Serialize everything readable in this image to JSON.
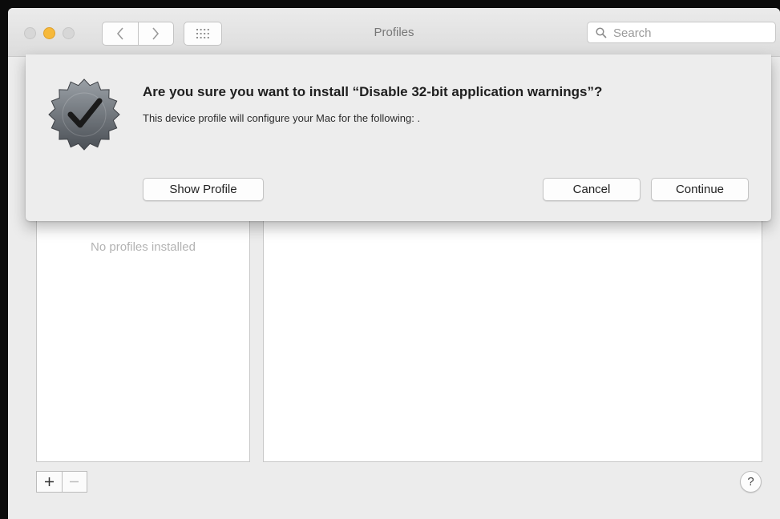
{
  "window": {
    "title": "Profiles"
  },
  "search": {
    "placeholder": "Search"
  },
  "profiles_list": {
    "empty_text": "No profiles installed"
  },
  "dialog": {
    "title": "Are you sure you want to install “Disable 32-bit application warnings”?",
    "message": "This device profile will configure your Mac for the following: .",
    "show_profile_label": "Show Profile",
    "cancel_label": "Cancel",
    "continue_label": "Continue"
  },
  "toolbar_bottom": {
    "add_label": "+",
    "remove_label": "−",
    "help_label": "?"
  },
  "icons": {
    "back": "chevron-left-icon",
    "forward": "chevron-right-icon",
    "grid": "grid-icon",
    "search": "search-icon",
    "badge": "verified-checkmark-badge-icon"
  },
  "colors": {
    "minimize_button": "#f6b93b",
    "window_background": "#ececec",
    "sheet_background": "#ededed"
  }
}
